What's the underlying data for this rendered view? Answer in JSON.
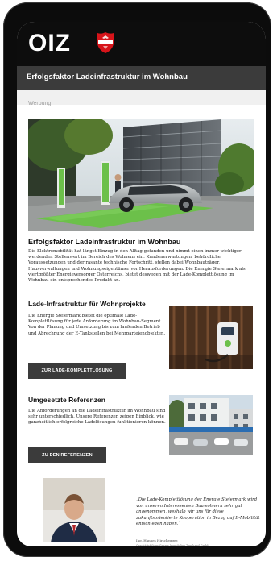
{
  "header": {
    "logo_text": "OIZ",
    "logo_icon": "austrian-eagle-shield-icon",
    "page_title": "Erfolgsfaktor Ladeinfrastruktur im Wohnbau"
  },
  "ad_label": "Werbung",
  "article": {
    "headline": "Erfolgsfaktor Ladeinfrastruktur im Wohnbau",
    "intro": "Die Elektromobilität hat längst Einzug in den Alltag gefunden und nimmt einen immer wichtiger werdenden Stellenwert im Bereich des Wohnens ein. Kundenerwartungen, behördliche Voraussetzungen und der rasante technische Fortschritt, stellen dabei Wohnbauträger, Hausverwaltungen und Wohnungseigentümer vor Herausforderungen. Die Energie Steiermark als viertgrößter Energieversorger Österreichs, bietet deswegen mit der Lade-Komplettlösung im Wohnbau ein entsprechendes Produkt an."
  },
  "section1": {
    "title": "Lade-Infrastruktur für Wohnprojekte",
    "text": "Die Energie Steiermark bietet die optimale Lade-Komplettlösung für jede Anforderung im Wohnbau-Segment. Von der Planung und Umsetzung bis zum laufenden Betrieb und Abrechnung der E-Tankstellen bei Mehrparteienobjekten.",
    "button": "ZUR LADE-KOMPLETTLÖSUNG"
  },
  "section2": {
    "title": "Umgesetzte Referenzen",
    "text": "Die Anforderungen an die Ladeinfrastruktur im Wohnbau sind sehr unterschiedlich. Unsere Referenzen zeigen Einblick, wie ganzheitlich erfolgreiche Ladelösungen funktionieren können.",
    "button": "ZU DEN REFERENZEN"
  },
  "testimonial": {
    "quote": "„Die Lade-Komplettlösung der Energie Steiermark wird von unseren Interessenten Bauwohnern sehr gut angenommen, weshalb wir uns für diese zukunftsorientierte Kooperation in Bezug auf E-Mobilität entschieden haben.“",
    "name": "Ing. Hannes Hirschegger,",
    "role": "Geschäftsführer Grazer Immobilien Treuhand GmbH"
  },
  "colors": {
    "header_bg": "#0d0d0d",
    "title_bar_bg": "#3b3b3b",
    "button_bg": "#3b3b3b",
    "logo_red": "#d7141a",
    "charger_green": "#6cc04a"
  }
}
